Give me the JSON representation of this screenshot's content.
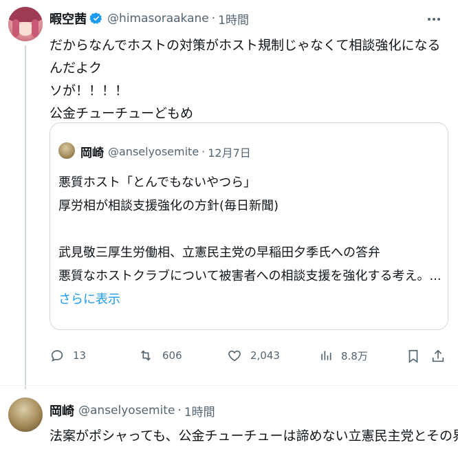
{
  "tweet": {
    "display_name": "暇空茜",
    "handle": "@himasoraakane",
    "separator": "·",
    "time": "1時間",
    "lines": [
      "だからなんでホストの対策がホスト規制じゃなくて相談強化になるんだよク",
      "ソが！！！！",
      "公金チューチューどもめ"
    ],
    "quote": {
      "display_name": "岡崎",
      "handle": "@anselyosemite",
      "separator": "·",
      "time": "12月7日",
      "lines": [
        "悪質ホスト「とんでもないやつら」",
        "厚労相が相談支援強化の方針(毎日新聞)",
        "",
        "武見敬三厚生労働相、立憲民主党の早稲田夕季氏への答弁",
        "悪質なホストクラブについて被害者への相談支援を強化する考え。..."
      ],
      "show_more": "さらに表示"
    },
    "actions": {
      "replies": "13",
      "retweets": "606",
      "likes": "2,043",
      "views": "8.8万"
    },
    "icons": {
      "verified": "verified-badge-icon",
      "more": "more-icon",
      "reply": "reply-icon",
      "retweet": "retweet-icon",
      "like": "like-icon",
      "views": "views-icon",
      "bookmark": "bookmark-icon",
      "share": "share-icon"
    }
  },
  "reply_tweet": {
    "display_name": "岡崎",
    "handle": "@anselyosemite",
    "separator": "·",
    "time": "1時間",
    "text": "法案がポシャっても、公金チューチューは諦めない立憲民主党とその界隈"
  },
  "colors": {
    "accent": "#1d9bf0",
    "muted": "#536471",
    "border": "#cfd9de",
    "text": "#0f1419"
  }
}
